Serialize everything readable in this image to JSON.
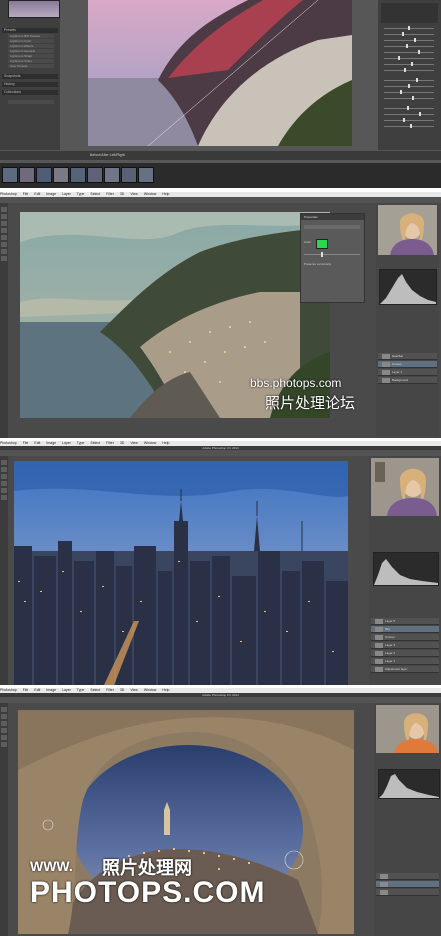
{
  "panel1": {
    "left_sections": [
      "Presets",
      "Snapshots",
      "History",
      "Collections"
    ],
    "presets": [
      "Lightroom BW Presets",
      "Lightroom Color",
      "Lightroom Effects",
      "Lightroom General",
      "Lightroom Sharp",
      "Lightroom Video",
      "User Presets"
    ],
    "bottom_buttons": [
      "Copy...",
      "Paste"
    ],
    "toolbar_text": "Before/After Left/Right",
    "filmstrip_count": 9,
    "right_buttons": [
      "Previous",
      "Reset"
    ]
  },
  "panel2": {
    "menu": [
      "Photoshop",
      "File",
      "Edit",
      "Image",
      "Layer",
      "Type",
      "Select",
      "Filter",
      "3D",
      "View",
      "Window",
      "Help"
    ],
    "dialog_title": "Properties",
    "dialog_rows": [
      "Color",
      "Preserve Luminosity"
    ],
    "layers": [
      "Hue/Sat",
      "Curves",
      "Layer 1",
      "Background"
    ],
    "watermark_line1": "bbs.photops.com",
    "watermark_line2": "照片处理论坛"
  },
  "panel3": {
    "menu": [
      "Photoshop",
      "File",
      "Edit",
      "Image",
      "Layer",
      "Type",
      "Select",
      "Filter",
      "3D",
      "View",
      "Window",
      "Help"
    ],
    "window_title": "Adobe Photoshop CC 2014",
    "layers": [
      "Layer 5",
      "Sky",
      "Curves",
      "Layer 3",
      "Layer 2",
      "Layer 1",
      "Adjustment layer"
    ]
  },
  "panel4": {
    "menu": [
      "Photoshop",
      "File",
      "Edit",
      "Image",
      "Layer",
      "Type",
      "Select",
      "Filter",
      "3D",
      "View",
      "Window",
      "Help"
    ],
    "window_title": "Adobe Photoshop CC 2014",
    "watermark_www": "WWW.",
    "watermark_cn": "照片处理网",
    "watermark_big": "PHOTOPS.COM"
  },
  "colors": {
    "ps_bg": "#4a4a4a",
    "lr_bg": "#575757",
    "swatch_green": "#27d84a",
    "selected_layer": "#607080"
  }
}
